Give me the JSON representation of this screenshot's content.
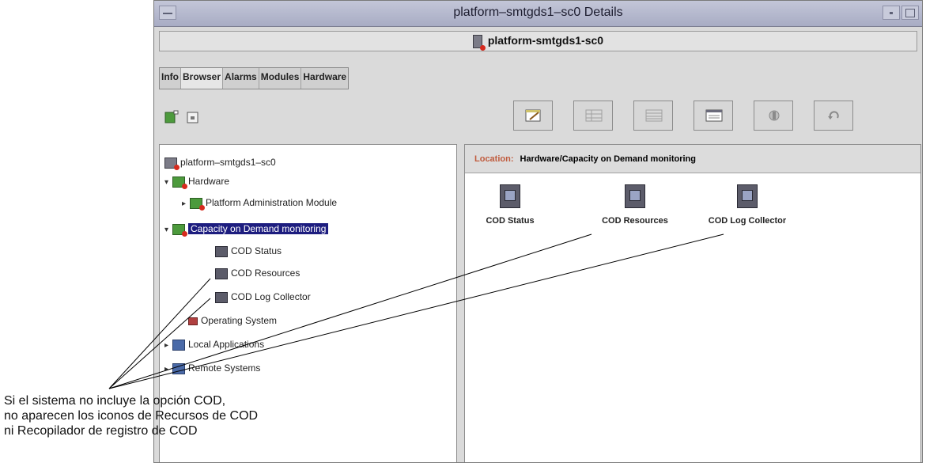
{
  "window": {
    "title": "platform–smtgds1–sc0 Details",
    "host": "platform-smtgds1-sc0"
  },
  "tabs": [
    "Info",
    "Browser",
    "Alarms",
    "Modules",
    "Hardware"
  ],
  "tree": {
    "nodes": [
      {
        "label": "platform–smtgds1–sc0"
      },
      {
        "label": "Hardware"
      },
      {
        "label": "Platform Administration Module"
      },
      {
        "label": "Capacity on Demand monitoring"
      },
      {
        "label": "COD Status"
      },
      {
        "label": "COD Resources"
      },
      {
        "label": "COD Log Collector"
      },
      {
        "label": "Operating System"
      },
      {
        "label": "Local Applications"
      },
      {
        "label": "Remote Systems"
      }
    ]
  },
  "location": {
    "label": "Location:",
    "path": "Hardware/Capacity on Demand monitoring"
  },
  "icons": [
    {
      "label": "COD Status"
    },
    {
      "label": "COD Resources"
    },
    {
      "label": "COD Log Collector"
    }
  ],
  "caption": {
    "lines": [
      "Si el sistema no incluye la opción COD,",
      "no aparecen los iconos de Recursos de COD",
      "ni Recopilador de registro de COD"
    ]
  }
}
